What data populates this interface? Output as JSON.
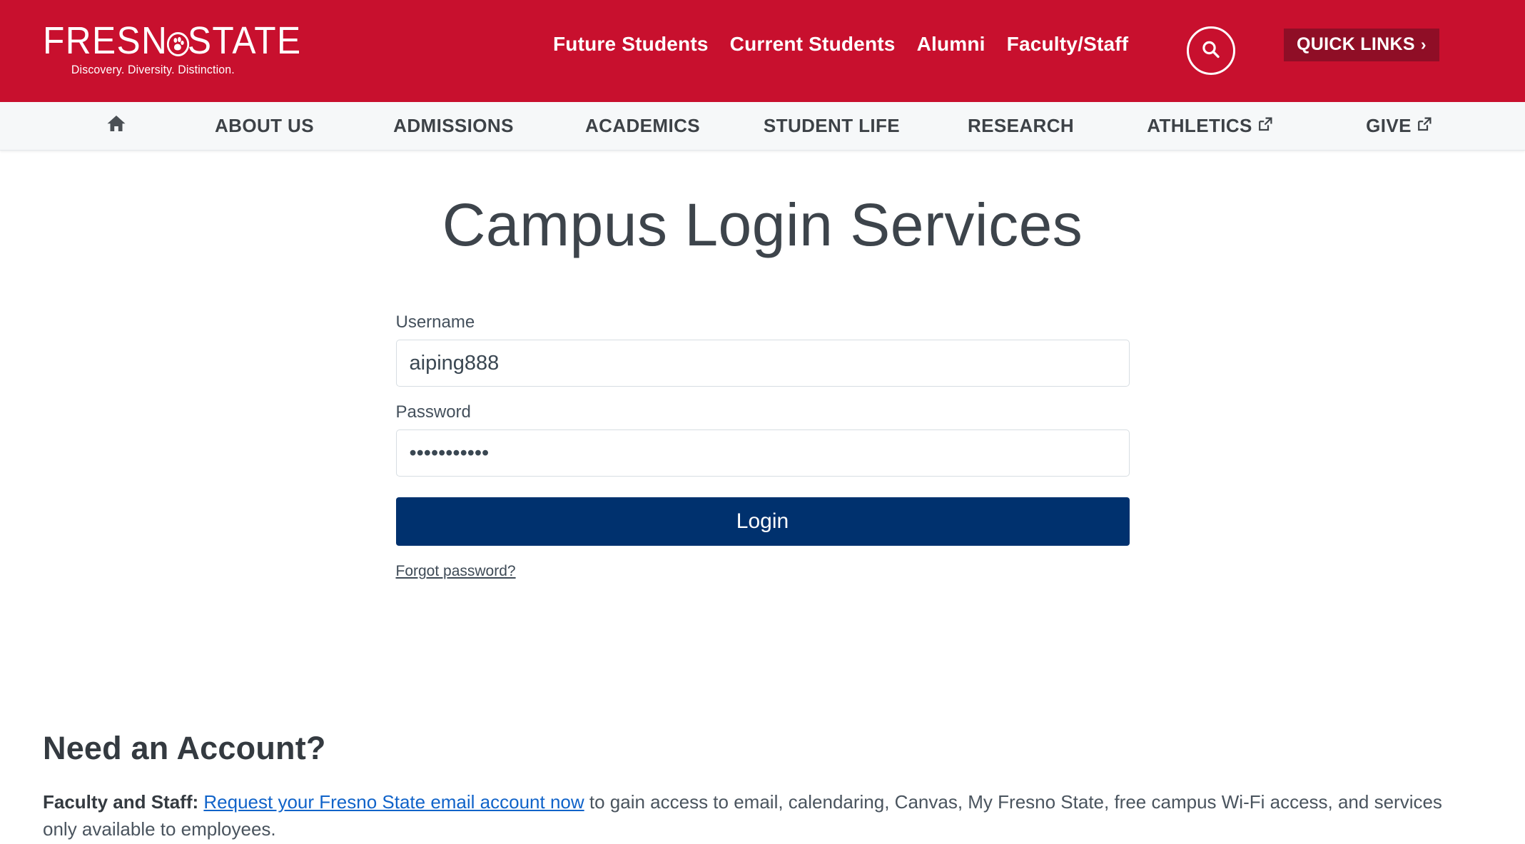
{
  "brand": {
    "logo_word_1": "FRESN",
    "logo_word_2": "STATE",
    "tagline": "Discovery. Diversity. Distinction.",
    "red": "#c8102e",
    "dark_red": "#8f0e26",
    "navy": "#00316e",
    "link_blue": "#1063c9"
  },
  "header": {
    "audience_nav": [
      {
        "label": "Future Students"
      },
      {
        "label": "Current Students"
      },
      {
        "label": "Alumni"
      },
      {
        "label": "Faculty/Staff"
      }
    ],
    "search_icon": "search-icon",
    "quick_links_label": "QUICK LINKS",
    "quick_links_chevron": "›"
  },
  "mainnav": {
    "home_icon": "home-icon",
    "items": [
      {
        "label": "ABOUT US",
        "external": false
      },
      {
        "label": "ADMISSIONS",
        "external": false
      },
      {
        "label": "ACADEMICS",
        "external": false
      },
      {
        "label": "STUDENT LIFE",
        "external": false
      },
      {
        "label": "RESEARCH",
        "external": false
      },
      {
        "label": "ATHLETICS",
        "external": true
      },
      {
        "label": "GIVE",
        "external": true
      }
    ]
  },
  "main": {
    "page_title": "Campus Login Services",
    "form": {
      "username_label": "Username",
      "username_value": "aiping888",
      "username_placeholder": "",
      "password_label": "Password",
      "password_value": "•••••••••••",
      "password_placeholder": "",
      "login_label": "Login",
      "forgot_label": "Forgot password?"
    },
    "need_account": {
      "heading": "Need an Account?",
      "faculty_prefix": "Faculty and Staff:",
      "faculty_link": "Request your Fresno State email account now",
      "faculty_rest": " to gain access to email, calendaring, Canvas, My Fresno State, free campus Wi-Fi access, and services only available to employees."
    }
  }
}
